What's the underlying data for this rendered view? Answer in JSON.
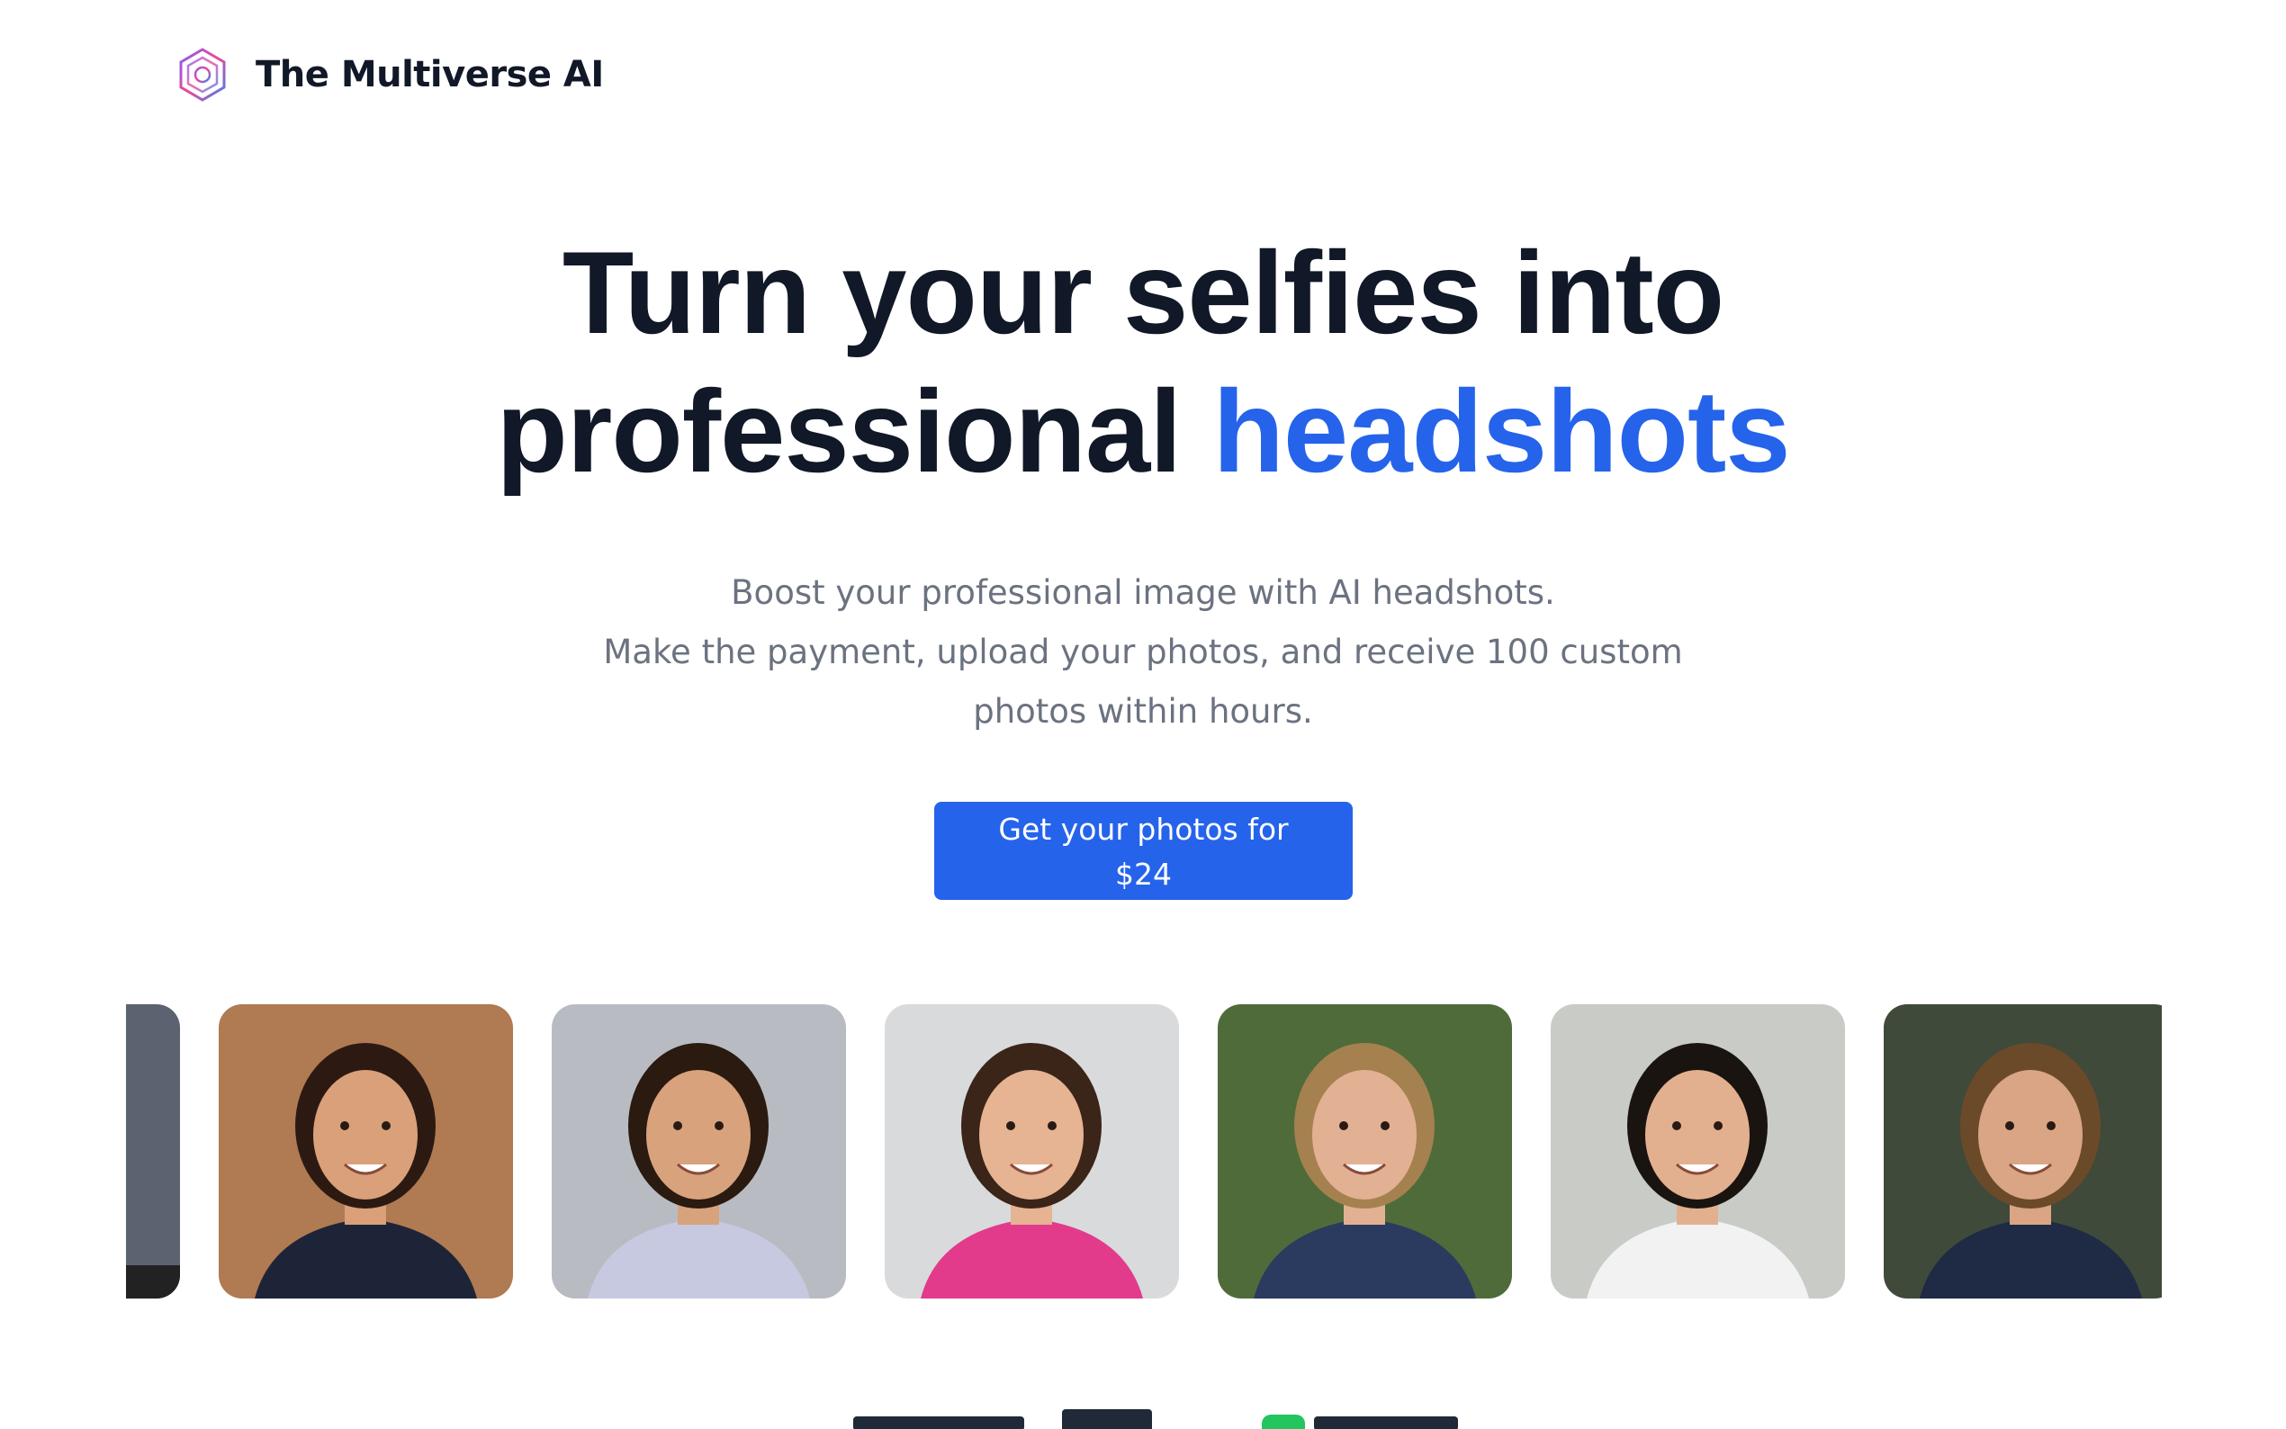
{
  "header": {
    "brand": "The Multiverse AI",
    "logo_icon": "hexagon-gradient-icon"
  },
  "hero": {
    "title_line1": "Turn your selfies into",
    "title_line2_plain": "professional ",
    "title_line2_accent": "headshots",
    "accent_color": "#2563eb",
    "subtitle_lines": [
      "Boost your professional image with AI headshots.",
      "Make the payment, upload your photos, and receive 100 custom",
      "photos within hours."
    ],
    "cta_label": "Get your photos for $24"
  },
  "photos": [
    {
      "kind": "partial",
      "bg": "#5b6270",
      "skin": "#333"
    },
    {
      "kind": "headshot",
      "bg": "#b07a52",
      "skin": "#d9a07a",
      "hair": "#2c1a12",
      "shirt": "#1e2438"
    },
    {
      "kind": "headshot",
      "bg": "#b8bcc2",
      "skin": "#d8a27c",
      "hair": "#2a1a10",
      "shirt": "#c6c9e0"
    },
    {
      "kind": "headshot",
      "bg": "#d9dadc",
      "skin": "#e6b393",
      "hair": "#3b2418",
      "shirt": "#e23b8c"
    },
    {
      "kind": "headshot",
      "bg": "#4f6b3a",
      "skin": "#e2b193",
      "hair": "#a5814f",
      "shirt": "#2b3b60"
    },
    {
      "kind": "headshot",
      "bg": "#c9cbc6",
      "skin": "#e2b08f",
      "hair": "#1a1410",
      "shirt": "#f2f2f2"
    },
    {
      "kind": "headshot",
      "bg": "#3f4a3a",
      "skin": "#d9a585",
      "hair": "#6b4a2a",
      "shirt": "#1f2a44"
    }
  ]
}
